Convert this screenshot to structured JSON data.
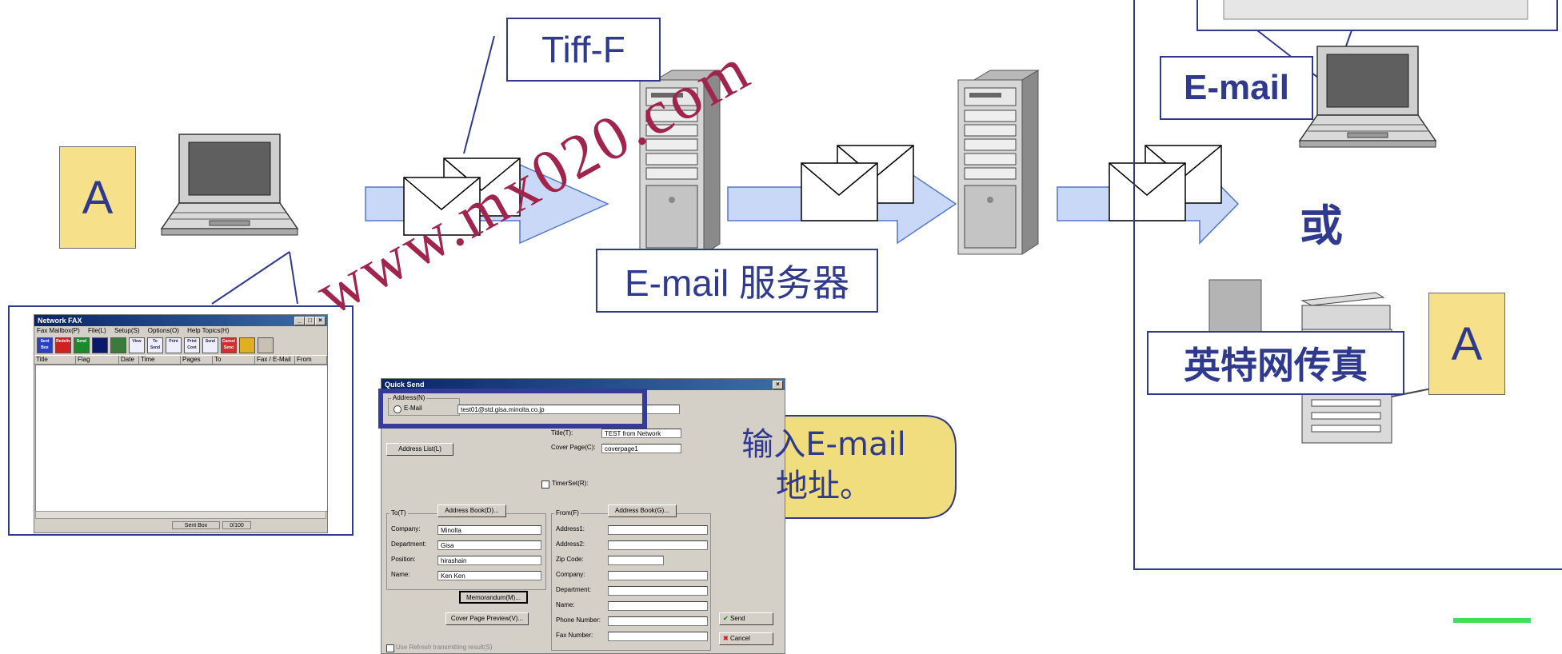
{
  "labels": {
    "doc_a_left": "A",
    "tiff_f": "Tiff-F",
    "email_server": "E-mail 服务器",
    "email_right": "E-mail",
    "or": "或",
    "internet_fax": "英特网传真",
    "doc_a_right": "A",
    "callout": "输入E-mail\n地址。"
  },
  "watermark": "www.mx020.com",
  "network_fax": {
    "title": "Network FAX",
    "menu": [
      "Fax Mailbox(P)",
      "File(L)",
      "Setup(S)",
      "Options(O)",
      "Help Topics(H)"
    ],
    "toolbar": [
      "Sent Box",
      "Redeliv",
      "Send",
      "",
      "",
      "View",
      "To Send",
      "Print",
      "Print Cont",
      "Send",
      "Cancel Send",
      "",
      ""
    ],
    "columns": [
      "Title",
      "Flag",
      "Date",
      "Time",
      "Pages",
      "To",
      "Fax / E-Mail",
      "From"
    ],
    "status_box": "Sent Box",
    "status_count": "0/100"
  },
  "quick_send": {
    "title": "Quick Send",
    "address_group": "Address(N)",
    "email_option": "E-Mail",
    "email_value": "test01@std.gisa.minolta.co.jp",
    "address_list_btn": "Address List(L)",
    "title_label": "Title(T):",
    "title_value": "TEST from Network",
    "cover_label": "Cover Page(C):",
    "cover_value": "coverpage1",
    "timerset": "TimerSet(R):",
    "to_group": "To(T)",
    "to_book_btn": "Address Book(D)...",
    "to_fields": [
      {
        "label": "Company:",
        "value": "Minolta"
      },
      {
        "label": "Department:",
        "value": "Gisa"
      },
      {
        "label": "Position:",
        "value": "hirashain"
      },
      {
        "label": "Name:",
        "value": "Ken Ken"
      }
    ],
    "from_group": "From(F)",
    "from_book_btn": "Address Book(G)...",
    "from_fields": [
      "Address1:",
      "Address2:",
      "Zip Code:",
      "Company:",
      "Department:",
      "Name:",
      "Phone Number:",
      "Fax Number:"
    ],
    "memo_btn": "Memorandum(M)...",
    "preview_btn": "Cover Page Preview(V)...",
    "send_btn": "Send",
    "cancel_btn": "Cancel",
    "refresh_label": "Use Refresh transmitting result(S)"
  },
  "colors": {
    "navy": "#2f3a8f",
    "note_yellow": "#f7e08a",
    "arrow_fill": "#c9d8f7",
    "watermark": "#a1244d",
    "highlight": "#333d99"
  }
}
